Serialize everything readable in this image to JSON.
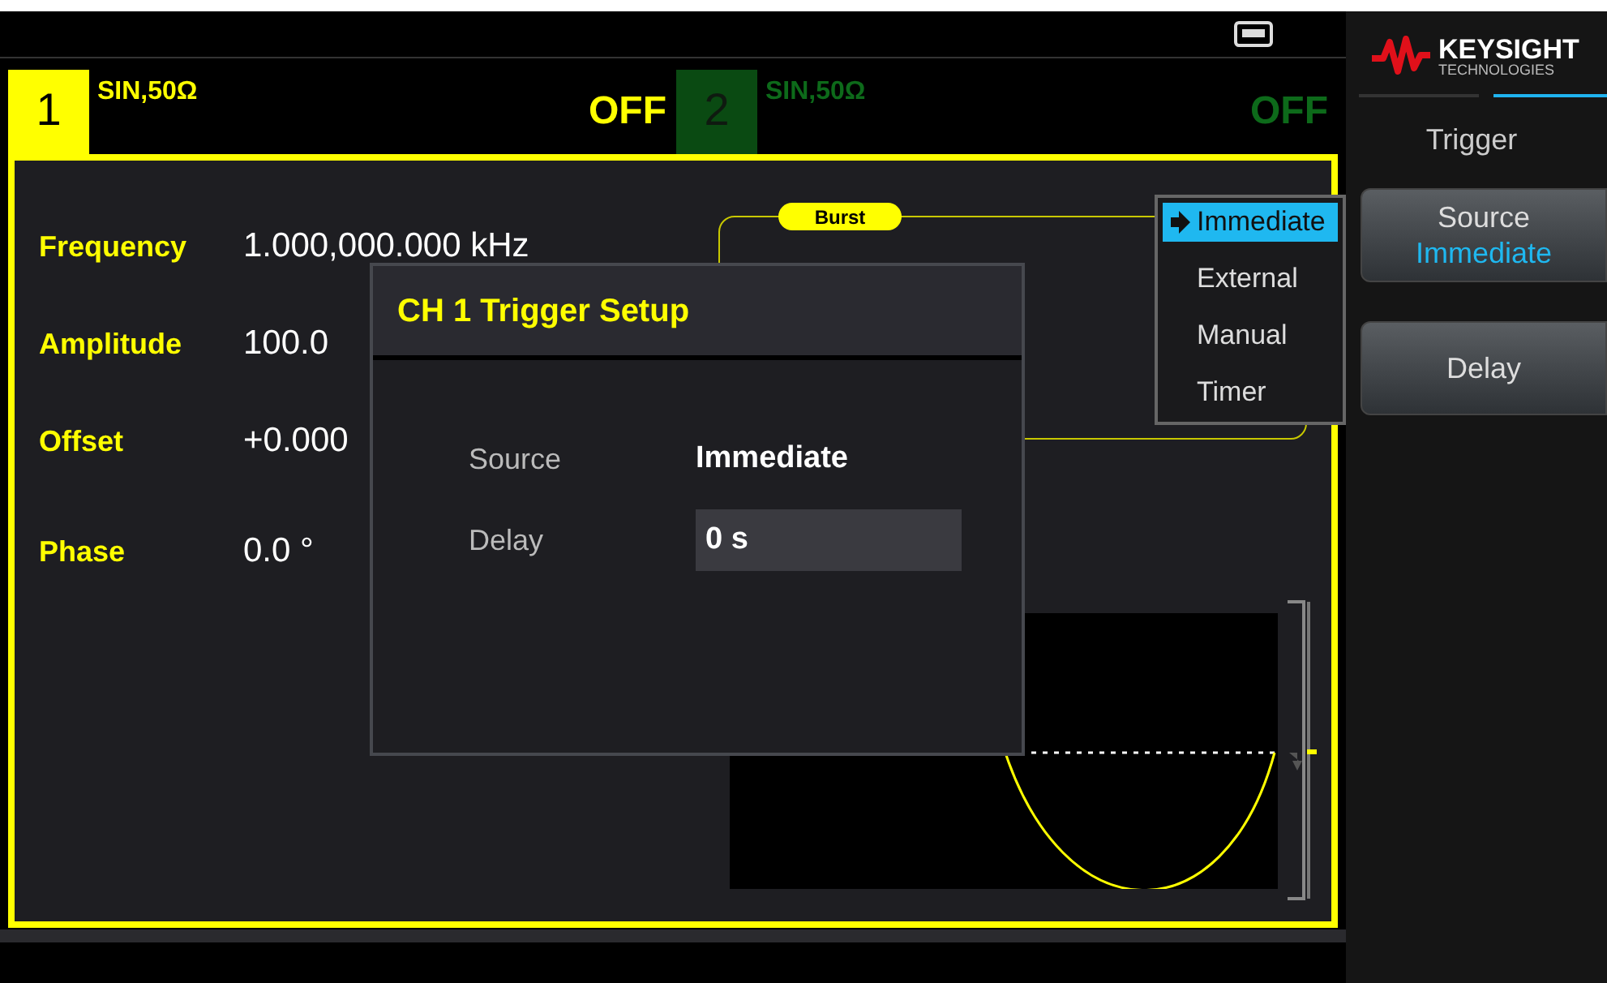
{
  "channels": [
    {
      "number": "1",
      "waveform": "SIN,50Ω",
      "output": "OFF",
      "selected": true
    },
    {
      "number": "2",
      "waveform": "SIN,50Ω",
      "output": "OFF",
      "selected": false
    }
  ],
  "parameters": [
    {
      "label": "Frequency",
      "value": "1.000,000.000 kHz"
    },
    {
      "label": "Amplitude",
      "value": "100.0"
    },
    {
      "label": "Offset",
      "value": "+0.000"
    },
    {
      "label": "Phase",
      "value": "0.0 °"
    }
  ],
  "burst": {
    "label": "Burst"
  },
  "trigger_menu": {
    "items": [
      {
        "label": "Immediate",
        "selected": true
      },
      {
        "label": "External",
        "selected": false
      },
      {
        "label": "Manual",
        "selected": false
      },
      {
        "label": "Timer",
        "selected": false
      }
    ]
  },
  "dialog": {
    "title": "CH 1 Trigger Setup",
    "fields": [
      {
        "label": "Source",
        "value": "Immediate",
        "kind": "text"
      },
      {
        "label": "Delay",
        "value": "0 s",
        "kind": "input"
      }
    ]
  },
  "softkey_panel": {
    "brand": "KEYSIGHT",
    "brand_sub": "TECHNOLOGIES",
    "title": "Trigger",
    "softkeys": [
      {
        "label": "Source",
        "value": "Immediate"
      },
      {
        "label": "Delay"
      }
    ]
  }
}
